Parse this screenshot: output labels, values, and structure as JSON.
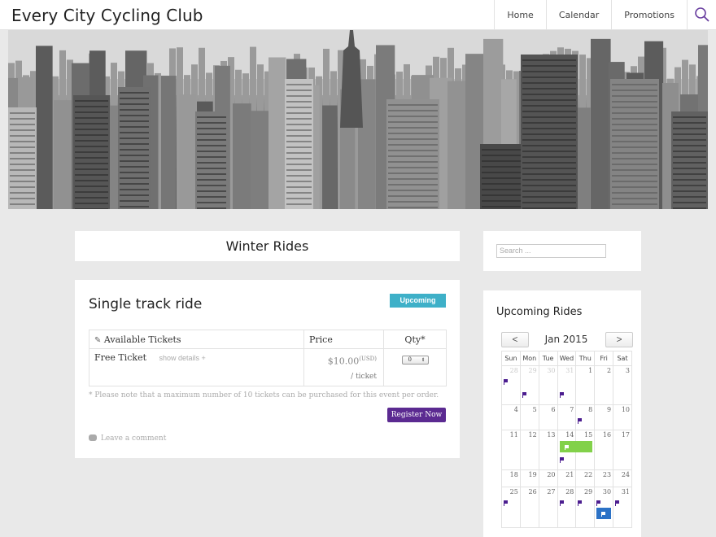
{
  "site": {
    "title": "Every City Cycling Club"
  },
  "nav": {
    "items": [
      "Home",
      "Calendar",
      "Promotions"
    ]
  },
  "colors": {
    "accent": "#5b2a91",
    "badge": "#3eb0c8",
    "event_green": "#82d14a",
    "event_blue": "#2c72c6"
  },
  "page": {
    "title": "Winter Rides"
  },
  "event": {
    "title": "Single track ride",
    "status_badge": "Upcoming",
    "tickets_table": {
      "headers": {
        "name": "Available Tickets",
        "price": "Price",
        "qty": "Qty*"
      },
      "rows": [
        {
          "name": "Free Ticket",
          "details_link": "show details +",
          "price": "$10.00",
          "currency": "(USD)",
          "per": "/ ticket",
          "qty": "0"
        }
      ]
    },
    "note": "* Please note that a maximum number of 10 tickets can be purchased for this event per order.",
    "register_label": "Register Now",
    "comment_label": "Leave a comment"
  },
  "sidebar": {
    "search": {
      "placeholder": "Search ..."
    },
    "calendar": {
      "title": "Upcoming Rides",
      "month_label": "Jan 2015",
      "prev_label": "<",
      "next_label": ">",
      "weekdays": [
        "Sun",
        "Mon",
        "Tue",
        "Wed",
        "Thu",
        "Fri",
        "Sat"
      ],
      "weeks": [
        [
          "28",
          "29",
          "30",
          "31",
          "1",
          "2",
          "3"
        ],
        [
          "4",
          "5",
          "6",
          "7",
          "8",
          "9",
          "10"
        ],
        [
          "11",
          "12",
          "13",
          "14",
          "15",
          "16",
          "17"
        ],
        [
          "18",
          "19",
          "20",
          "21",
          "22",
          "23",
          "24"
        ],
        [
          "25",
          "26",
          "27",
          "28",
          "29",
          "30",
          "31"
        ]
      ]
    }
  }
}
